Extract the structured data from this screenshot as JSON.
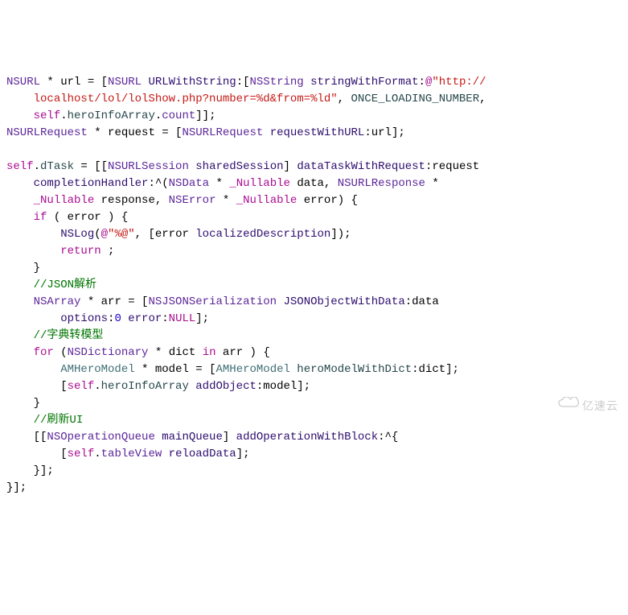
{
  "code": {
    "line1": {
      "type1": "NSURL",
      "op1": " * ",
      "var1": "url = [",
      "type2": "NSURL",
      "method1": " URLWithString",
      "colon1": ":[",
      "type3": "NSString",
      "method2": " stringWithFormat",
      "colon2": ":",
      "at": "@",
      "string1": "\"http://"
    },
    "line2": {
      "indent": "    ",
      "string2": "localhost/lol/lolShow.php?number=%d&from=%ld\"",
      "comma": ", ",
      "const1": "ONCE_LOADING_NUMBER",
      "comma2": ","
    },
    "line3": {
      "indent": "    ",
      "self": "self",
      "dot1": ".",
      "prop1": "heroInfoArray",
      "dot2": ".",
      "prop2": "count",
      "close": "]];"
    },
    "line4": {
      "type1": "NSURLRequest",
      "op": " * ",
      "var": "request = [",
      "type2": "NSURLRequest",
      "method": " requestWithURL",
      "colon": ":",
      "arg": "url];"
    },
    "line6": {
      "self": "self",
      "dot": ".",
      "prop": "dTask",
      "eq": " = [[",
      "type": "NSURLSession",
      "method1": " sharedSession",
      "close1": "] ",
      "method2": "dataTaskWithRequest",
      "colon": ":",
      "arg": "request"
    },
    "line7": {
      "indent": "    ",
      "method": "completionHandler",
      "colon": ":^(",
      "type1": "NSData",
      "op1": " * ",
      "nullable1": "_Nullable",
      "arg1": " data, ",
      "type2": "NSURLResponse",
      "op2": " *"
    },
    "line8": {
      "indent": "    ",
      "nullable1": "_Nullable",
      "arg1": " response, ",
      "type1": "NSError",
      "op1": " * ",
      "nullable2": "_Nullable",
      "arg2": " error) {"
    },
    "line9": {
      "indent": "    ",
      "kw": "if",
      "text": " ( error ) {"
    },
    "line10": {
      "indent": "        ",
      "fn": "NSLog",
      "open": "(",
      "at": "@",
      "str": "\"%@\"",
      "mid": ", [error ",
      "method": "localizedDescription",
      "close": "]);"
    },
    "line11": {
      "indent": "        ",
      "kw": "return",
      "semi": " ;"
    },
    "line12": {
      "indent": "    ",
      "close": "}"
    },
    "line13": {
      "indent": "    ",
      "comment": "//JSON解析"
    },
    "line14": {
      "indent": "    ",
      "type1": "NSArray",
      "op": " * ",
      "var": "arr = [",
      "type2": "NSJSONSerialization",
      "method": " JSONObjectWithData",
      "colon": ":",
      "arg": "data"
    },
    "line15": {
      "indent": "        ",
      "method1": "options",
      "colon1": ":",
      "num": "0",
      "space": " ",
      "method2": "error",
      "colon2": ":",
      "null": "NULL",
      "close": "];"
    },
    "line16": {
      "indent": "    ",
      "comment": "//字典转模型"
    },
    "line17": {
      "indent": "    ",
      "kw1": "for",
      "open": " (",
      "type": "NSDictionary",
      "op": " * ",
      "var": "dict ",
      "kw2": "in",
      "arr": " arr ) {"
    },
    "line18": {
      "indent": "        ",
      "type1": "AMHeroModel",
      "op": " * ",
      "var": "model = [",
      "type2": "AMHeroModel",
      "method": " heroModelWithDict",
      "colon": ":",
      "arg": "dict];"
    },
    "line19": {
      "indent": "        ",
      "open": "[",
      "self": "self",
      "dot": ".",
      "prop": "heroInfoArray",
      "method": " addObject",
      "colon": ":",
      "arg": "model];"
    },
    "line20": {
      "indent": "    ",
      "close": "}"
    },
    "line21": {
      "indent": "    ",
      "comment": "//刷新UI"
    },
    "line22": {
      "indent": "    ",
      "open": "[[",
      "type": "NSOperationQueue",
      "method1": " mainQueue",
      "close1": "] ",
      "method2": "addOperationWithBlock",
      "colon": ":^{"
    },
    "line23": {
      "indent": "        ",
      "open": "[",
      "self": "self",
      "dot": ".",
      "prop": "tableView",
      "method": " reloadData",
      "close": "];"
    },
    "line24": {
      "indent": "    ",
      "close": "}];"
    },
    "line25": {
      "close": "}];"
    }
  },
  "watermark": {
    "text": "亿速云"
  }
}
